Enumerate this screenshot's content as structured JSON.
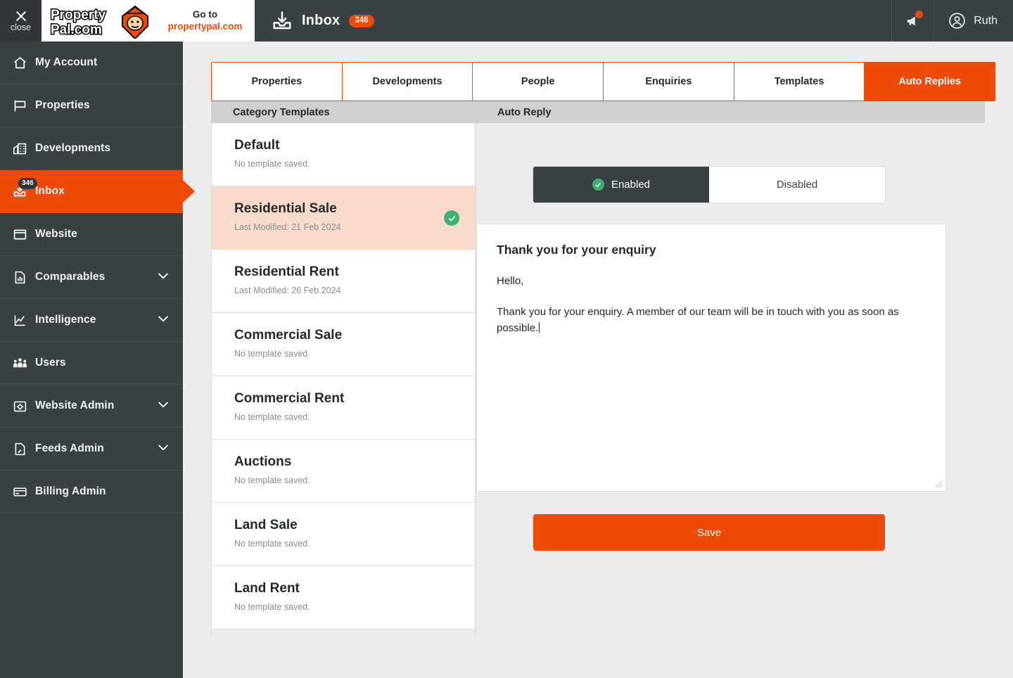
{
  "header": {
    "close_label": "close",
    "logo_alt": "PropertyPal.com",
    "goto_top": "Go to",
    "goto_link": "propertypal.com",
    "inbox_label": "Inbox",
    "inbox_count": "346",
    "user_name": "Ruth",
    "announcements_icon": "megaphone-icon",
    "account_icon": "user-circle-icon"
  },
  "sidebar": {
    "items": [
      {
        "label": "My Account",
        "icon": "home-icon",
        "active": false,
        "chevron": false,
        "badge": null
      },
      {
        "label": "Properties",
        "icon": "sign-icon",
        "active": false,
        "chevron": false,
        "badge": null
      },
      {
        "label": "Developments",
        "icon": "buildings-icon",
        "active": false,
        "chevron": false,
        "badge": null
      },
      {
        "label": "Inbox",
        "icon": "inbox-icon",
        "active": true,
        "chevron": false,
        "badge": "346"
      },
      {
        "label": "Website",
        "icon": "browser-icon",
        "active": false,
        "chevron": false,
        "badge": null
      },
      {
        "label": "Comparables",
        "icon": "chart-doc-icon",
        "active": false,
        "chevron": true,
        "badge": null
      },
      {
        "label": "Intelligence",
        "icon": "line-chart-icon",
        "active": false,
        "chevron": true,
        "badge": null
      },
      {
        "label": "Users",
        "icon": "people-icon",
        "active": false,
        "chevron": false,
        "badge": null
      },
      {
        "label": "Website Admin",
        "icon": "gear-folder-icon",
        "active": false,
        "chevron": true,
        "badge": null
      },
      {
        "label": "Feeds Admin",
        "icon": "feed-doc-icon",
        "active": false,
        "chevron": true,
        "badge": null
      },
      {
        "label": "Billing Admin",
        "icon": "credit-card-icon",
        "active": false,
        "chevron": false,
        "badge": null
      }
    ]
  },
  "tabs": [
    {
      "label": "Properties",
      "active": false
    },
    {
      "label": "Developments",
      "active": false
    },
    {
      "label": "People",
      "active": false
    },
    {
      "label": "Enquiries",
      "active": false
    },
    {
      "label": "Templates",
      "active": false
    },
    {
      "label": "Auto Replies",
      "active": true
    }
  ],
  "templates_panel": {
    "heading": "Category Templates",
    "items": [
      {
        "name": "Default",
        "status": "No template saved.",
        "selected": false,
        "has_tick": false
      },
      {
        "name": "Residential Sale",
        "status": "Last Modified: 21 Feb 2024",
        "selected": true,
        "has_tick": true
      },
      {
        "name": "Residential Rent",
        "status": "Last Modified: 26 Feb 2024",
        "selected": false,
        "has_tick": false
      },
      {
        "name": "Commercial Sale",
        "status": "No template saved.",
        "selected": false,
        "has_tick": false
      },
      {
        "name": "Commercial Rent",
        "status": "No template saved.",
        "selected": false,
        "has_tick": false
      },
      {
        "name": "Auctions",
        "status": "No template saved.",
        "selected": false,
        "has_tick": false
      },
      {
        "name": "Land Sale",
        "status": "No template saved.",
        "selected": false,
        "has_tick": false
      },
      {
        "name": "Land Rent",
        "status": "No template saved.",
        "selected": false,
        "has_tick": false
      }
    ]
  },
  "auto_reply_panel": {
    "heading": "Auto Reply",
    "toggle": {
      "enabled_label": "Enabled",
      "disabled_label": "Disabled",
      "selected": "Enabled"
    },
    "editor": {
      "title": "Thank you for your enquiry",
      "greeting": "Hello,",
      "body": "Thank you for your enquiry. A member of our team will be in touch with you as soon as possible."
    },
    "save_label": "Save"
  },
  "colors": {
    "brand_orange": "#ee4a0a",
    "sidebar_dark": "#3a4145",
    "selected_peach": "#fadbcb",
    "success_green": "#3cb173",
    "page_bg": "#ececec"
  }
}
